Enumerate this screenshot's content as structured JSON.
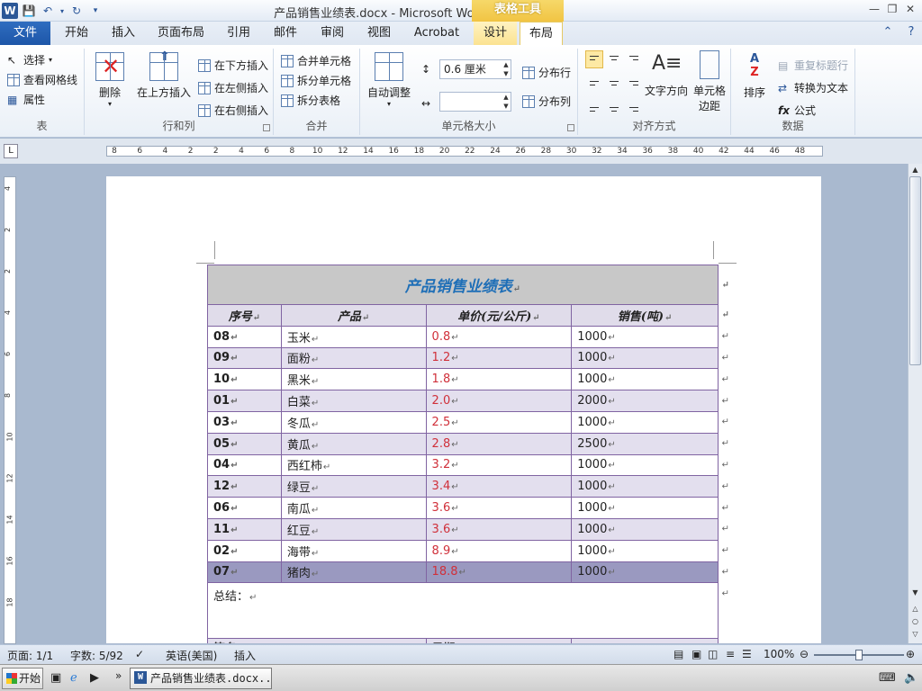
{
  "titlebar": {
    "title": "产品销售业绩表.docx - Microsoft Word",
    "context_header": "表格工具"
  },
  "tabs": [
    {
      "label": "文件"
    },
    {
      "label": "开始"
    },
    {
      "label": "插入"
    },
    {
      "label": "页面布局"
    },
    {
      "label": "引用"
    },
    {
      "label": "邮件"
    },
    {
      "label": "审阅"
    },
    {
      "label": "视图"
    },
    {
      "label": "Acrobat"
    },
    {
      "label": "设计"
    },
    {
      "label": "布局"
    }
  ],
  "ribbon": {
    "table": {
      "select": "选择",
      "gridlines": "查看网格线",
      "properties": "属性",
      "label": "表"
    },
    "rows_cols": {
      "delete": "删除",
      "insert_above": "在上方插入",
      "insert_below": "在下方插入",
      "insert_left": "在左侧插入",
      "insert_right": "在右侧插入",
      "label": "行和列"
    },
    "merge": {
      "merge_cells": "合并单元格",
      "split_cells": "拆分单元格",
      "split_table": "拆分表格",
      "label": "合并"
    },
    "cell_size": {
      "autofit": "自动调整",
      "height_value": "0.6 厘米",
      "width_value": "",
      "distribute_rows": "分布行",
      "distribute_cols": "分布列",
      "label": "单元格大小"
    },
    "alignment": {
      "text_direction": "文字方向",
      "cell_margins_1": "单元格",
      "cell_margins_2": "边距",
      "label": "对齐方式"
    },
    "data": {
      "sort": "排序",
      "repeat_header": "重复标题行",
      "convert_to_text": "转换为文本",
      "formula": "公式",
      "label": "数据"
    }
  },
  "ruler": {
    "h_ticks": [
      "8",
      "6",
      "4",
      "2",
      "2",
      "4",
      "6",
      "8",
      "10",
      "12",
      "14",
      "16",
      "18",
      "20",
      "22",
      "24",
      "26",
      "28",
      "30",
      "32",
      "34",
      "36",
      "38",
      "40",
      "42",
      "44",
      "46",
      "48"
    ],
    "v_ticks": [
      "4",
      "2",
      "2",
      "4",
      "6",
      "8",
      "10",
      "12",
      "14",
      "16",
      "18"
    ]
  },
  "table": {
    "title": "产品销售业绩表",
    "headers": [
      "序号",
      "产品",
      "单价(元/公斤)",
      "销售(吨)"
    ],
    "rows": [
      {
        "id": "08",
        "product": "玉米",
        "price": "0.8",
        "sales": "1000"
      },
      {
        "id": "09",
        "product": "面粉",
        "price": "1.2",
        "sales": "1000"
      },
      {
        "id": "10",
        "product": "黑米",
        "price": "1.8",
        "sales": "1000"
      },
      {
        "id": "01",
        "product": "白菜",
        "price": "2.0",
        "sales": "2000"
      },
      {
        "id": "03",
        "product": "冬瓜",
        "price": "2.5",
        "sales": "1000"
      },
      {
        "id": "05",
        "product": "黄瓜",
        "price": "2.8",
        "sales": "2500"
      },
      {
        "id": "04",
        "product": "西红柿",
        "price": "3.2",
        "sales": "1000"
      },
      {
        "id": "12",
        "product": "绿豆",
        "price": "3.4",
        "sales": "1000"
      },
      {
        "id": "06",
        "product": "南瓜",
        "price": "3.6",
        "sales": "1000"
      },
      {
        "id": "11",
        "product": "红豆",
        "price": "3.6",
        "sales": "1000"
      },
      {
        "id": "02",
        "product": "海带",
        "price": "8.9",
        "sales": "1000"
      },
      {
        "id": "07",
        "product": "猪肉",
        "price": "18.8",
        "sales": "1000"
      }
    ],
    "summary_label": "总结：",
    "sign_label": "签名",
    "date_label": "日期"
  },
  "statusbar": {
    "page": "页面: 1/1",
    "words": "字数: 5/92",
    "language": "英语(美国)",
    "mode": "插入",
    "zoom": "100%"
  },
  "taskbar": {
    "start": "开始",
    "task_word": "产品销售业绩表.docx..."
  },
  "colors": {
    "accent": "#2b579a",
    "table_border": "#8064a2",
    "title_color": "#1f6fb7",
    "price_color": "#d0303a"
  }
}
